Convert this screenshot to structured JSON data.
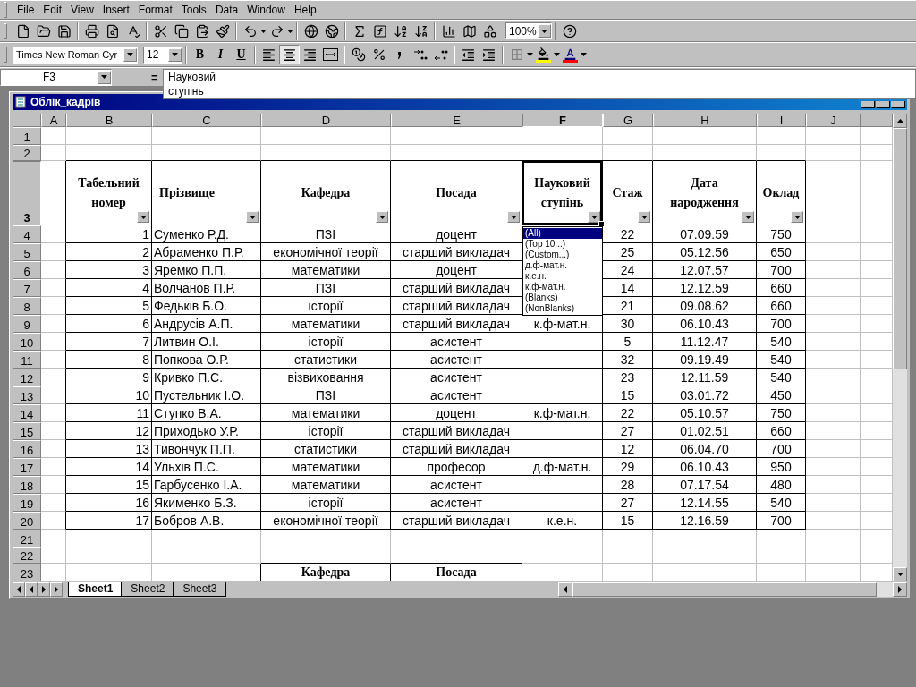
{
  "menu": [
    "File",
    "Edit",
    "View",
    "Insert",
    "Format",
    "Tools",
    "Data",
    "Window",
    "Help"
  ],
  "standard_toolbar": {
    "zoom": "100%"
  },
  "formatting_toolbar": {
    "font": "Times New Roman Cyr",
    "size": "12",
    "style_buttons": [
      {
        "kind": "bold",
        "label": "B",
        "selected": false
      },
      {
        "kind": "italic",
        "label": "I",
        "selected": false
      },
      {
        "kind": "underline",
        "label": "U",
        "selected": false
      }
    ],
    "align_buttons": [
      {
        "kind": "left",
        "selected": false
      },
      {
        "kind": "center",
        "selected": true
      },
      {
        "kind": "right",
        "selected": false
      }
    ]
  },
  "formula_bar": {
    "name_box": "F3",
    "equals": "=",
    "value": "Науковий\nступінь"
  },
  "workbook": {
    "title": "Облік_кадрів",
    "columns": [
      {
        "label": "A",
        "selected": false
      },
      {
        "label": "B",
        "selected": false
      },
      {
        "label": "C",
        "selected": false
      },
      {
        "label": "D",
        "selected": false
      },
      {
        "label": "E",
        "selected": false
      },
      {
        "label": "F",
        "selected": true
      },
      {
        "label": "G",
        "selected": false
      },
      {
        "label": "H",
        "selected": false
      },
      {
        "label": "I",
        "selected": false
      },
      {
        "label": "J",
        "selected": false
      }
    ],
    "rows": [
      {
        "number": "1",
        "kind": "blank",
        "selected": false
      },
      {
        "number": "2",
        "kind": "blank",
        "selected": false
      },
      {
        "number": "3",
        "kind": "header",
        "selected": true,
        "cells": [
          null,
          {
            "text": "Табельний номер",
            "active": false
          },
          {
            "text": "Прізвище",
            "active": false
          },
          {
            "text": "Кафедра",
            "active": false
          },
          {
            "text": "Посада",
            "active": false
          },
          {
            "text": "Науковий ступінь",
            "active": true
          },
          {
            "text": "Стаж",
            "active": false
          },
          {
            "text": "Дата народження",
            "active": false
          },
          {
            "text": "Оклад",
            "active": false
          },
          null
        ]
      },
      {
        "number": "4",
        "kind": "data",
        "selected": false,
        "cells": [
          null,
          "1",
          "Суменко Р.Д.",
          "ПЗІ",
          "доцент",
          null,
          "22",
          "07.09.59",
          "750",
          null
        ]
      },
      {
        "number": "5",
        "kind": "data",
        "selected": false,
        "cells": [
          null,
          "2",
          "Абраменко П.Р.",
          "економічної теорії",
          "старший викладач",
          null,
          "25",
          "05.12.56",
          "650",
          null
        ]
      },
      {
        "number": "6",
        "kind": "data",
        "selected": false,
        "cells": [
          null,
          "3",
          "Яремко П.П.",
          "математики",
          "доцент",
          null,
          "24",
          "12.07.57",
          "700",
          null
        ]
      },
      {
        "number": "7",
        "kind": "data",
        "selected": false,
        "cells": [
          null,
          "4",
          "Волчанов П.Р.",
          "ПЗІ",
          "старший викладач",
          null,
          "14",
          "12.12.59",
          "660",
          null
        ]
      },
      {
        "number": "8",
        "kind": "data",
        "selected": false,
        "cells": [
          null,
          "5",
          "Федьків Б.О.",
          "історії",
          "старший викладач",
          null,
          "21",
          "09.08.62",
          "660",
          null
        ]
      },
      {
        "number": "9",
        "kind": "data",
        "selected": false,
        "cells": [
          null,
          "6",
          "Андрусів А.П.",
          "математики",
          "старший викладач",
          "к.ф-мат.н.",
          "30",
          "06.10.43",
          "700",
          null
        ]
      },
      {
        "number": "10",
        "kind": "data",
        "selected": false,
        "cells": [
          null,
          "7",
          "Литвин О.І.",
          "історії",
          "асистент",
          null,
          "5",
          "11.12.47",
          "540",
          null
        ]
      },
      {
        "number": "11",
        "kind": "data",
        "selected": false,
        "cells": [
          null,
          "8",
          "Попкова О.Р.",
          "статистики",
          "асистент",
          null,
          "32",
          "09.19.49",
          "540",
          null
        ]
      },
      {
        "number": "12",
        "kind": "data",
        "selected": false,
        "cells": [
          null,
          "9",
          "Кривко П.С.",
          "візвиховання",
          "асистент",
          null,
          "23",
          "12.11.59",
          "540",
          null
        ]
      },
      {
        "number": "13",
        "kind": "data",
        "selected": false,
        "cells": [
          null,
          "10",
          "Пустельник І.О.",
          "ПЗІ",
          "асистент",
          null,
          "15",
          "03.01.72",
          "450",
          null
        ]
      },
      {
        "number": "14",
        "kind": "data",
        "selected": false,
        "cells": [
          null,
          "11",
          "Ступко В.А.",
          "математики",
          "доцент",
          "к.ф-мат.н.",
          "22",
          "05.10.57",
          "750",
          null
        ]
      },
      {
        "number": "15",
        "kind": "data",
        "selected": false,
        "cells": [
          null,
          "12",
          "Приходько У.Р.",
          "історії",
          "старший викладач",
          null,
          "27",
          "01.02.51",
          "660",
          null
        ]
      },
      {
        "number": "16",
        "kind": "data",
        "selected": false,
        "cells": [
          null,
          "13",
          "Тивончук П.П.",
          "статистики",
          "старший викладач",
          null,
          "12",
          "06.04.70",
          "700",
          null
        ]
      },
      {
        "number": "17",
        "kind": "data",
        "selected": false,
        "cells": [
          null,
          "14",
          "Ульхів П.С.",
          "математики",
          "професор",
          "д.ф-мат.н.",
          "29",
          "06.10.43",
          "950",
          null
        ]
      },
      {
        "number": "18",
        "kind": "data",
        "selected": false,
        "cells": [
          null,
          "15",
          "Гарбусенко І.А.",
          "математики",
          "асистент",
          null,
          "28",
          "07.17.54",
          "480",
          null
        ]
      },
      {
        "number": "19",
        "kind": "data",
        "selected": false,
        "cells": [
          null,
          "16",
          "Якименко Б.З.",
          "історії",
          "асистент",
          null,
          "27",
          "12.14.55",
          "540",
          null
        ]
      },
      {
        "number": "20",
        "kind": "data",
        "selected": false,
        "cells": [
          null,
          "17",
          "Бобров А.В.",
          "економічної теорії",
          "старший викладач",
          "к.е.н.",
          "15",
          "12.16.59",
          "700",
          null
        ]
      },
      {
        "number": "21",
        "kind": "blank",
        "selected": false
      },
      {
        "number": "22",
        "kind": "blank",
        "selected": false
      },
      {
        "number": "23",
        "kind": "footer",
        "selected": false,
        "cells": [
          null,
          null,
          null,
          "Кафедра",
          "Посада",
          null,
          null,
          null,
          null,
          null
        ]
      }
    ],
    "filter_dropdown": {
      "items": [
        {
          "label": "(All)",
          "selected": true
        },
        {
          "label": "(Top 10...)",
          "selected": false
        },
        {
          "label": "(Custom...)",
          "selected": false
        },
        {
          "label": "д.ф-мат.н.",
          "selected": false
        },
        {
          "label": "к.е.н.",
          "selected": false
        },
        {
          "label": "к.ф-мат.н.",
          "selected": false
        },
        {
          "label": "(Blanks)",
          "selected": false
        },
        {
          "label": "(NonBlanks)",
          "selected": false
        }
      ]
    },
    "sheet_tabs": [
      {
        "label": "Sheet1",
        "selected": true
      },
      {
        "label": "Sheet2",
        "selected": false
      },
      {
        "label": "Sheet3",
        "selected": false
      }
    ]
  }
}
